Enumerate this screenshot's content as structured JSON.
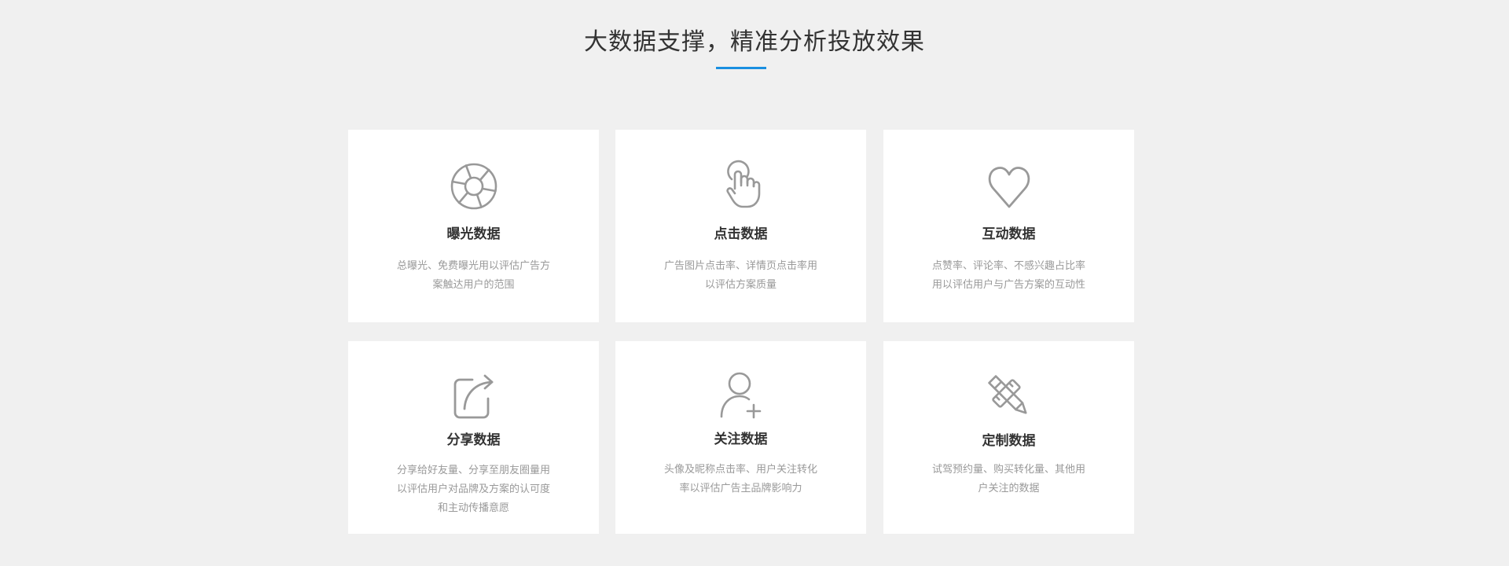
{
  "section": {
    "title": "大数据支撑，精准分析投放效果",
    "accent_color": "#1a8fe0"
  },
  "cards": [
    {
      "icon": "aperture-icon",
      "title": "曝光数据",
      "desc_lines": [
        "总曝光、免费曝光用以评估广告方",
        "案触达用户的范围"
      ]
    },
    {
      "icon": "pointer-hand-icon",
      "title": "点击数据",
      "desc_lines": [
        "广告图片点击率、详情页点击率用",
        "以评估方案质量"
      ]
    },
    {
      "icon": "heart-icon",
      "title": "互动数据",
      "desc_lines": [
        "点赞率、评论率、不感兴趣占比率",
        "用以评估用户与广告方案的互动性"
      ]
    },
    {
      "icon": "share-icon",
      "title": "分享数据",
      "desc_lines": [
        "分享给好友量、分享至朋友圈量用",
        "以评估用户对品牌及方案的认可度",
        "和主动传播意愿"
      ]
    },
    {
      "icon": "user-add-icon",
      "title": "关注数据",
      "desc_lines": [
        "头像及昵称点击率、用户关注转化",
        "率以评估广告主品牌影响力"
      ]
    },
    {
      "icon": "pencil-ruler-icon",
      "title": "定制数据",
      "desc_lines": [
        "试驾预约量、购买转化量、其他用",
        "户关注的数据"
      ]
    }
  ]
}
